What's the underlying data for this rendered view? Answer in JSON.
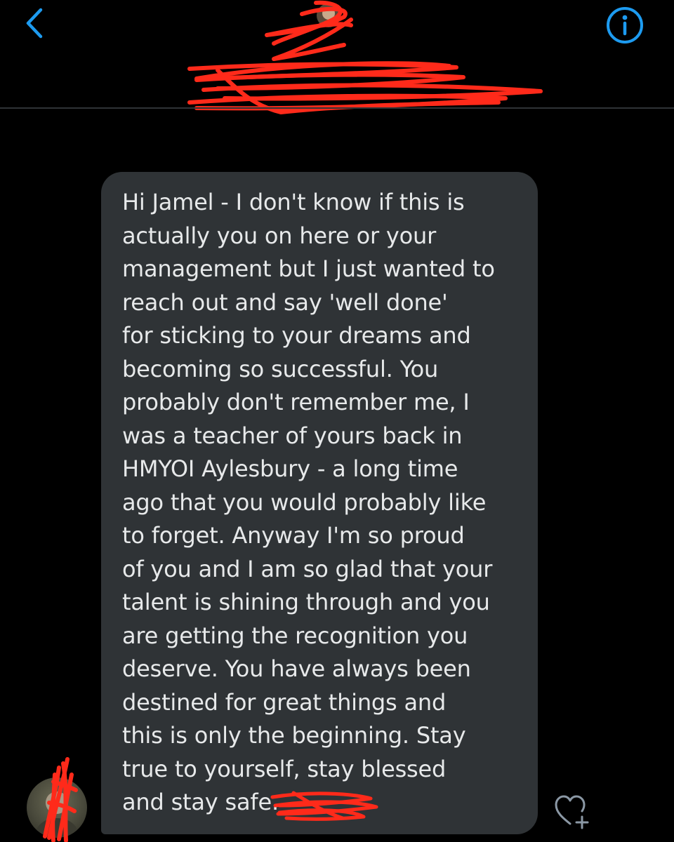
{
  "header": {
    "back_icon": "chevron-left-icon",
    "info_icon": "info-icon",
    "conversation_name": "",
    "accent_color": "#1d9bf0"
  },
  "message": {
    "text": "Hi Jamel - I don't know if this is\nactually you on here or your\nmanagement but I just wanted to\nreach out and say 'well done'\nfor sticking to your dreams and\nbecoming so successful. You\nprobably don't remember me, I\nwas a teacher of yours back in\nHMYOI Aylesbury - a  long time\nago that you would probably like\nto forget. Anyway I'm so proud\nof you and I am so glad that your\ntalent is shining through and you\nare getting the recognition you\ndeserve. You have always been\ndestined for great things and\nthis is only the beginning. Stay\ntrue to yourself,  stay blessed\nand stay safe.",
    "bubble_color": "#2f3336",
    "text_color": "#e7e9ea"
  },
  "actions": {
    "like_icon": "heart-plus-icon"
  },
  "redaction_color": "#ff2a1a"
}
